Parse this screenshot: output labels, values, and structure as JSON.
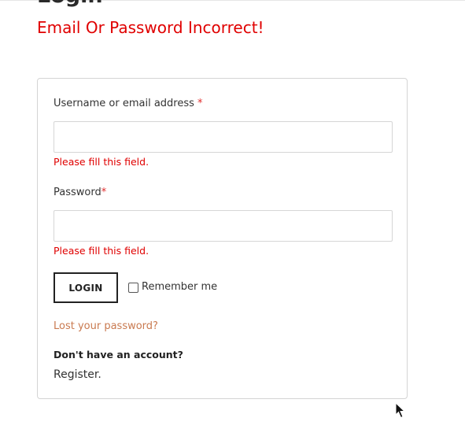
{
  "page": {
    "heading": "Login",
    "error_message": "Email Or Password Incorrect!"
  },
  "form": {
    "username": {
      "label": "Username or email address",
      "required_mark": "*",
      "value": "",
      "error": "Please fill this field."
    },
    "password": {
      "label": "Password",
      "required_mark": "*",
      "value": "",
      "error": "Please fill this field."
    },
    "login_button": "LOGIN",
    "remember_me": {
      "label": "Remember me",
      "checked": false
    },
    "lost_password_link": "Lost your password?",
    "no_account_text": "Don't have an account?",
    "register_link": "Register."
  },
  "colors": {
    "error": "#e00000",
    "required": "#e02b2b",
    "link": "#c97a50"
  }
}
